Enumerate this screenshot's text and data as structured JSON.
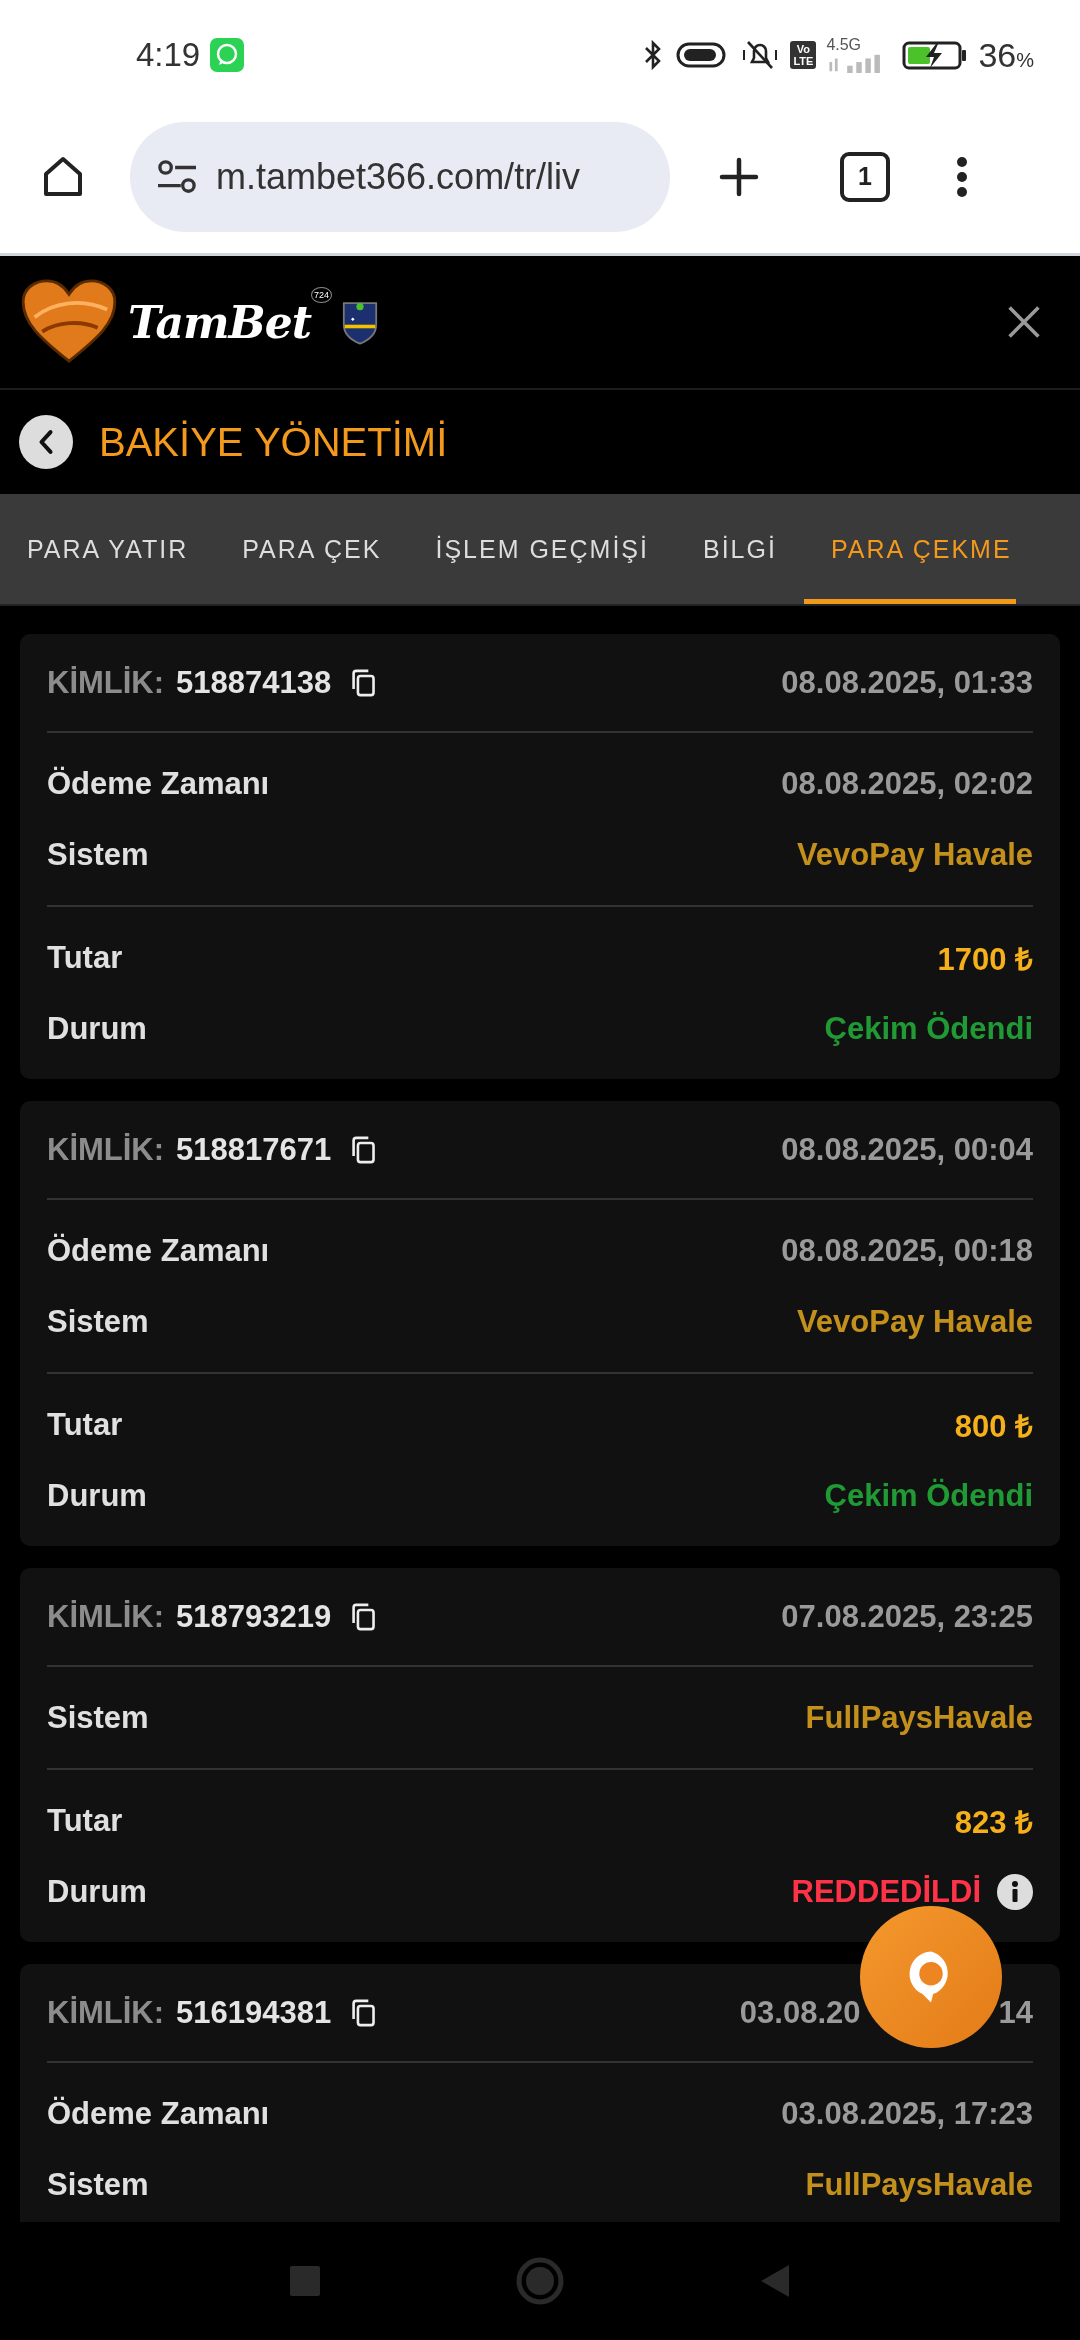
{
  "status_bar": {
    "time": "4:19",
    "network": "4.5G",
    "volte": [
      "Vo",
      "LTE"
    ],
    "battery": "36",
    "battery_unit": "%"
  },
  "browser": {
    "url": "m.tambet366.com/tr/liv",
    "tab_count": "1"
  },
  "header": {
    "brand": "TamBet",
    "brand_badge": "724"
  },
  "page_title": "BAKİYE YÖNETİMİ",
  "tabs": [
    {
      "label": "PARA YATIR",
      "selected": false
    },
    {
      "label": "PARA ÇEK",
      "selected": false
    },
    {
      "label": "İŞLEM GEÇMİŞİ",
      "selected": false
    },
    {
      "label": "BİLGİ",
      "selected": false
    },
    {
      "label": "PARA ÇEKME",
      "selected": true
    }
  ],
  "cards": [
    {
      "id_label": "KİMLİK:",
      "id": "518874138",
      "date": [
        "08.08.2025, 01:33"
      ],
      "sections": [
        [
          {
            "label": "Ödeme Zamanı",
            "value": "08.08.2025, 02:02",
            "kind": "time"
          },
          {
            "label": "Sistem",
            "value": "VevoPay Havale",
            "kind": "system"
          }
        ],
        [
          {
            "label": "Tutar",
            "value": "1700 ₺",
            "kind": "amount"
          },
          {
            "label": "Durum",
            "value": "Çekim Ödendi",
            "kind": "status",
            "color": "#1f9a35",
            "info": false
          }
        ]
      ]
    },
    {
      "id_label": "KİMLİK:",
      "id": "518817671",
      "date": [
        "08.08.2025, 00:04"
      ],
      "sections": [
        [
          {
            "label": "Ödeme Zamanı",
            "value": "08.08.2025, 00:18",
            "kind": "time"
          },
          {
            "label": "Sistem",
            "value": "VevoPay Havale",
            "kind": "system"
          }
        ],
        [
          {
            "label": "Tutar",
            "value": "800 ₺",
            "kind": "amount"
          },
          {
            "label": "Durum",
            "value": "Çekim Ödendi",
            "kind": "status",
            "color": "#1f9a35",
            "info": false
          }
        ]
      ]
    },
    {
      "id_label": "KİMLİK:",
      "id": "518793219",
      "date": [
        "07.08.2025, 23:25"
      ],
      "sections": [
        [
          {
            "label": "Sistem",
            "value": "FullPaysHavale",
            "kind": "system"
          }
        ],
        [
          {
            "label": "Tutar",
            "value": "823 ₺",
            "kind": "amount"
          },
          {
            "label": "Durum",
            "value": "REDDEDİLDİ",
            "kind": "status",
            "color": "#ff3347",
            "info": true
          }
        ]
      ]
    },
    {
      "id_label": "KİMLİK:",
      "id": "516194381",
      "date": [
        "03.08.20",
        "14"
      ],
      "sections": [
        [
          {
            "label": "Ödeme Zamanı",
            "value": "03.08.2025, 17:23",
            "kind": "time"
          },
          {
            "label": "Sistem",
            "value": "FullPaysHavale",
            "kind": "system"
          }
        ]
      ]
    }
  ]
}
